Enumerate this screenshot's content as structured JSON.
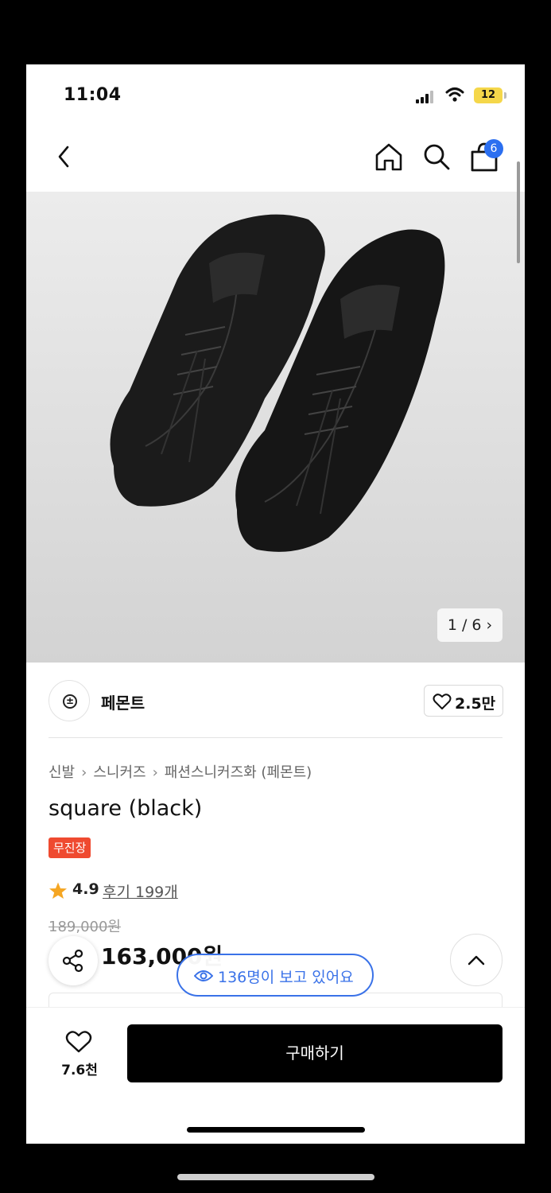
{
  "status_bar": {
    "time": "11:04",
    "battery": "12"
  },
  "nav": {
    "cart_badge": "6",
    "icons": [
      "back-chevron-icon",
      "home-icon",
      "search-icon",
      "shopping-bag-icon"
    ]
  },
  "gallery": {
    "counter": "1 / 6 ›"
  },
  "brand": {
    "name": "페몬트",
    "likes": "2.5만"
  },
  "breadcrumb": [
    "신발",
    "스니커즈",
    "패션스니커즈화 (페몬트)"
  ],
  "product": {
    "title": "square (black)",
    "tag": "무진장",
    "rating": "4.9",
    "reviews": "후기 199개",
    "original_price": "189,000원",
    "sale_price": "163,000원"
  },
  "viewers": {
    "text": "136명이 보고 있어요"
  },
  "bottom": {
    "wish_count": "7.6천",
    "buy_label": "구매하기"
  },
  "colors": {
    "accent_blue": "#3a72e8",
    "tag_red": "#ef4a30",
    "star": "#f5a623",
    "buy_bg": "#000000"
  }
}
